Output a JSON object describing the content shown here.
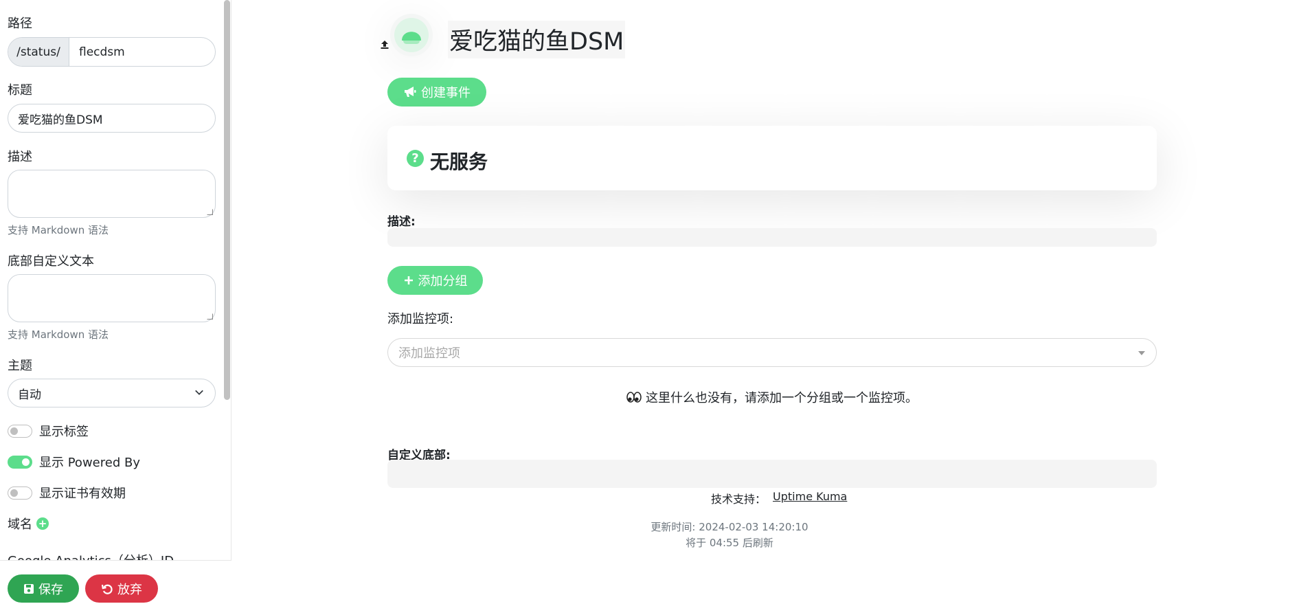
{
  "sidebar": {
    "path_label": "路径",
    "path_prefix": "/status/",
    "path_value": "flecdsm",
    "title_label": "标题",
    "title_value": "爱吃猫的鱼DSM",
    "description_label": "描述",
    "description_value": "",
    "description_hint": "支持 Markdown 语法",
    "footer_text_label": "底部自定义文本",
    "footer_text_value": "",
    "footer_text_hint": "支持 Markdown 语法",
    "theme_label": "主题",
    "theme_value": "自动",
    "toggles": [
      {
        "label": "显示标签",
        "on": false
      },
      {
        "label": "显示 Powered By",
        "on": true
      },
      {
        "label": "显示证书有效期",
        "on": false
      }
    ],
    "domain_label": "域名",
    "ga_label": "Google Analytics（分析）ID",
    "save_label": "保存",
    "discard_label": "放弃"
  },
  "main": {
    "page_title": "爱吃猫的鱼DSM",
    "create_incident_label": "创建事件",
    "status_text": "无服务",
    "description_label": "描述:",
    "add_group_label": "添加分组",
    "add_monitor_label": "添加监控项:",
    "add_monitor_placeholder": "添加监控项",
    "empty_message": "这里什么也没有，请添加一个分组或一个监控项。",
    "custom_footer_label": "自定义底部:",
    "powered_by_label": "技术支持：",
    "powered_by_link": "Uptime Kuma",
    "updated_at": "更新时间: 2024-02-03 14:20:10",
    "refresh_in": "将于 04:55 后刷新"
  },
  "colors": {
    "accent": "#5cdd8b",
    "save": "#2fa553",
    "discard": "#dc3545"
  }
}
